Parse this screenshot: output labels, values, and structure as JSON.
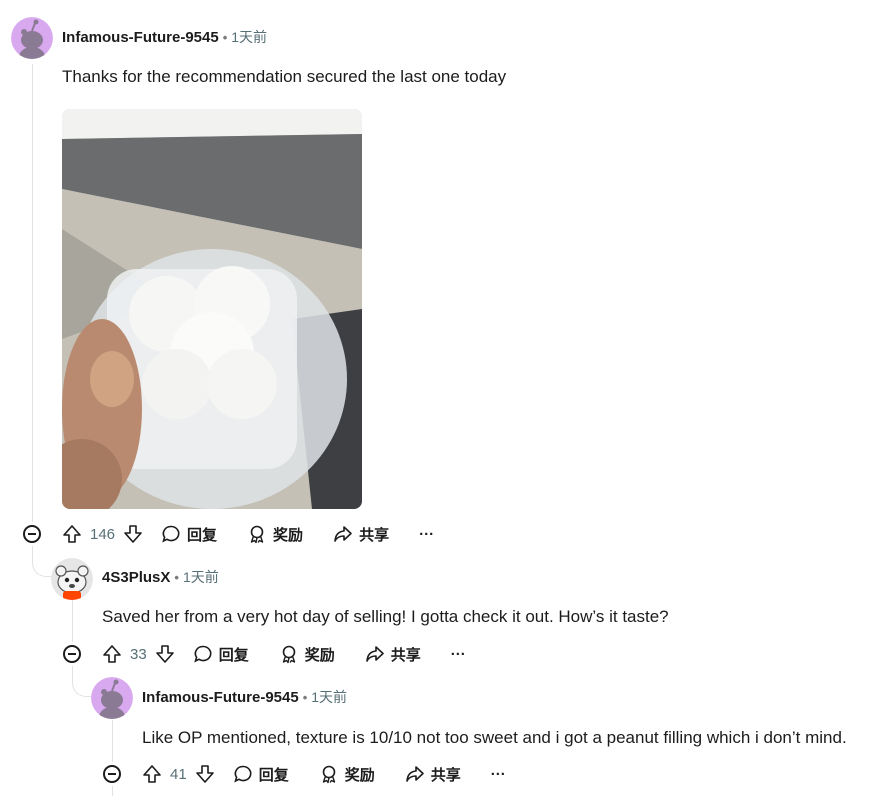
{
  "comments": [
    {
      "username": "Infamous-Future-9545",
      "time": "1天前",
      "text": "Thanks for the recommendation secured the last one today",
      "votes": "146",
      "reply_label": "回复",
      "award_label": "奖励",
      "share_label": "共享",
      "more_label": "···"
    },
    {
      "username": "4S3PlusX",
      "time": "1天前",
      "text": "Saved her from a very hot day of selling! I gotta check it out. How’s it taste?",
      "votes": "33",
      "reply_label": "回复",
      "award_label": "奖励",
      "share_label": "共享",
      "more_label": "···"
    },
    {
      "username": "Infamous-Future-9545",
      "time": "1天前",
      "text": "Like OP mentioned, texture is 10/10 not too sweet and i got a peanut filling which i don’t mind.",
      "votes": "41",
      "reply_label": "回复",
      "award_label": "奖励",
      "share_label": "共享",
      "more_label": "···"
    }
  ],
  "colors": {
    "avatar_purple": "#d9a9f0",
    "avatar_gray": "#e6e6e6",
    "meta_gray": "#576f76"
  }
}
